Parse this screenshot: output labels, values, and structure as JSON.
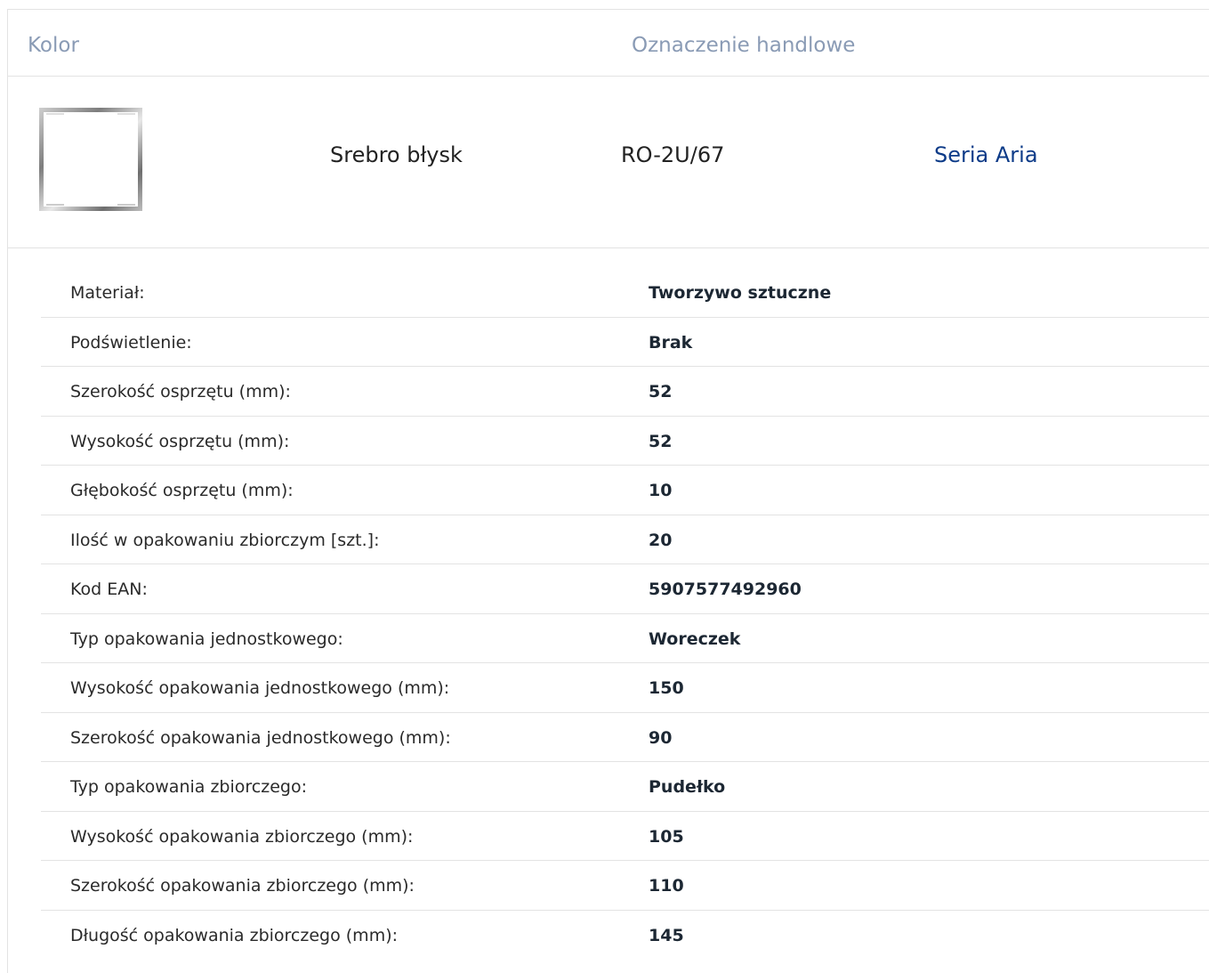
{
  "header": {
    "color_label": "Kolor",
    "trade_label": "Oznaczenie handlowe"
  },
  "product": {
    "color_name": "Srebro błysk",
    "code": "RO-2U/67",
    "series_link": "Seria Aria",
    "accent_color": "#0d3b88"
  },
  "specs": [
    {
      "label": "Materiał:",
      "value": "Tworzywo sztuczne"
    },
    {
      "label": "Podświetlenie:",
      "value": "Brak"
    },
    {
      "label": "Szerokość osprzętu (mm):",
      "value": "52"
    },
    {
      "label": "Wysokość osprzętu (mm):",
      "value": "52"
    },
    {
      "label": "Głębokość osprzętu (mm):",
      "value": "10"
    },
    {
      "label": "Ilość w opakowaniu zbiorczym [szt.]:",
      "value": "20"
    },
    {
      "label": "Kod EAN:",
      "value": "5907577492960"
    },
    {
      "label": "Typ opakowania jednostkowego:",
      "value": "Woreczek"
    },
    {
      "label": "Wysokość opakowania jednostkowego (mm):",
      "value": "150"
    },
    {
      "label": "Szerokość opakowania jednostkowego (mm):",
      "value": "90"
    },
    {
      "label": "Typ opakowania zbiorczego:",
      "value": "Pudełko"
    },
    {
      "label": "Wysokość opakowania zbiorczego (mm):",
      "value": "105"
    },
    {
      "label": "Szerokość opakowania zbiorczego (mm):",
      "value": "110"
    },
    {
      "label": "Długość opakowania zbiorczego (mm):",
      "value": "145"
    }
  ]
}
